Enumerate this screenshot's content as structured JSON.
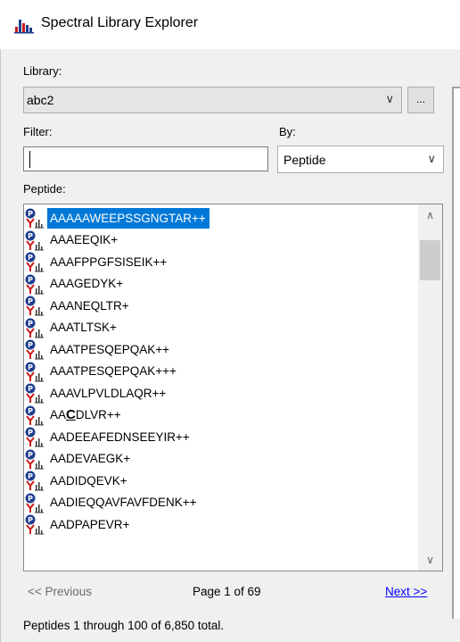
{
  "window": {
    "title": "Spectral Library Explorer",
    "icon": "spectral-library-icon"
  },
  "library": {
    "label": "Library:",
    "selected": "abc2",
    "browse_label": "..."
  },
  "filter": {
    "label": "Filter:",
    "value": ""
  },
  "by": {
    "label": "By:",
    "selected": "Peptide"
  },
  "peptide_list": {
    "label": "Peptide:",
    "selected_index": 0,
    "items": [
      {
        "pre": "AAAAAWEEPSSGNGTAR++",
        "mod": "",
        "post": ""
      },
      {
        "pre": "AAAEEQIK+",
        "mod": "",
        "post": ""
      },
      {
        "pre": "AAAFPPGFSISEIK++",
        "mod": "",
        "post": ""
      },
      {
        "pre": "AAAGEDYK+",
        "mod": "",
        "post": ""
      },
      {
        "pre": "AAANEQLTR+",
        "mod": "",
        "post": ""
      },
      {
        "pre": "AAATLTSK+",
        "mod": "",
        "post": ""
      },
      {
        "pre": "AAATPESQEPQAK++",
        "mod": "",
        "post": ""
      },
      {
        "pre": "AAATPESQEPQAK+++",
        "mod": "",
        "post": ""
      },
      {
        "pre": "AAAVLPVLDLAQR++",
        "mod": "",
        "post": ""
      },
      {
        "pre": "AA",
        "mod": "C",
        "post": "DLVR++"
      },
      {
        "pre": "AADEEAFEDNSEEYIR++",
        "mod": "",
        "post": ""
      },
      {
        "pre": "AADEVAEGK+",
        "mod": "",
        "post": ""
      },
      {
        "pre": "AADIDQEVK+",
        "mod": "",
        "post": ""
      },
      {
        "pre": "AADIEQQAVFAVFDENK++",
        "mod": "",
        "post": ""
      },
      {
        "pre": "AADPAPEVR+",
        "mod": "",
        "post": ""
      }
    ]
  },
  "pager": {
    "previous_label": "<< Previous",
    "page_label": "Page 1 of 69",
    "next_label": "Next >>"
  },
  "status": {
    "text": "Peptides 1 through 100 of 6,850 total."
  },
  "colors": {
    "selection": "#0078d7",
    "link": "#0000ff",
    "icon_blue": "#1f3d8f",
    "icon_red": "#cc1b1b"
  }
}
